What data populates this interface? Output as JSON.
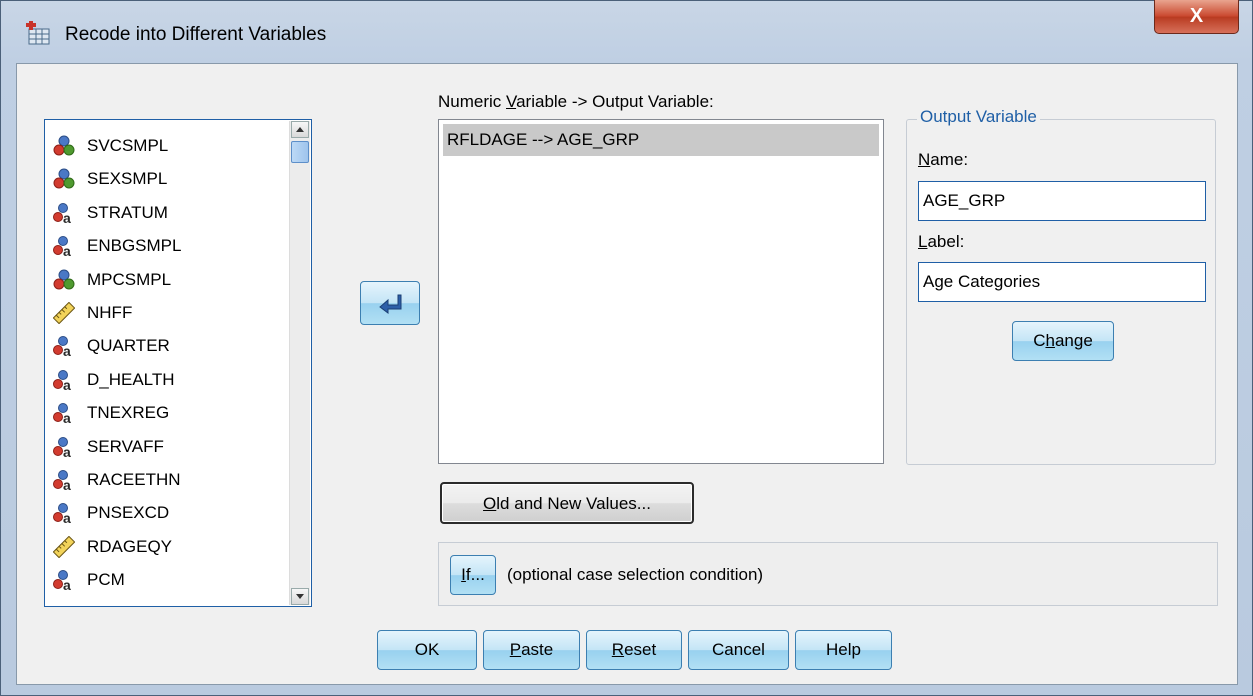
{
  "window": {
    "title": "Recode into Different Variables",
    "close_glyph": "X"
  },
  "variables": [
    {
      "name": "SVCSMPL",
      "icon": "nominal-icon"
    },
    {
      "name": "SEXSMPL",
      "icon": "nominal-icon"
    },
    {
      "name": "STRATUM",
      "icon": "nominal-string-icon"
    },
    {
      "name": "ENBGSMPL",
      "icon": "nominal-string-icon"
    },
    {
      "name": "MPCSMPL",
      "icon": "nominal-icon"
    },
    {
      "name": "NHFF",
      "icon": "scale-ruler-icon"
    },
    {
      "name": "QUARTER",
      "icon": "nominal-string-icon"
    },
    {
      "name": "D_HEALTH",
      "icon": "nominal-string-icon"
    },
    {
      "name": "TNEXREG",
      "icon": "nominal-string-icon"
    },
    {
      "name": "SERVAFF",
      "icon": "nominal-string-icon"
    },
    {
      "name": "RACEETHN",
      "icon": "nominal-string-icon"
    },
    {
      "name": "PNSEXCD",
      "icon": "nominal-string-icon"
    },
    {
      "name": "RDAGEQY",
      "icon": "scale-ruler-icon"
    },
    {
      "name": "PCM",
      "icon": "nominal-string-icon"
    }
  ],
  "mapping": {
    "label_pre": "Numeric ",
    "label_u": "V",
    "label_post": "ariable -> Output Variable:",
    "items": [
      "RFLDAGE --> AGE_GRP"
    ]
  },
  "output": {
    "group_title": "Output Variable",
    "name_label_u": "N",
    "name_label_post": "ame:",
    "name_value": "AGE_GRP",
    "label_label_u": "L",
    "label_label_post": "abel:",
    "label_value": "Age Categories",
    "change_pre": "C",
    "change_u": "h",
    "change_post": "ange"
  },
  "old_new": {
    "u": "O",
    "post": "ld and New Values..."
  },
  "if_panel": {
    "button_u": "I",
    "button_post": "f...",
    "text": "(optional case selection condition)"
  },
  "buttons": {
    "ok": "OK",
    "paste_u": "P",
    "paste_post": "aste",
    "reset_u": "R",
    "reset_post": "eset",
    "cancel": "Cancel",
    "help": "Help"
  }
}
